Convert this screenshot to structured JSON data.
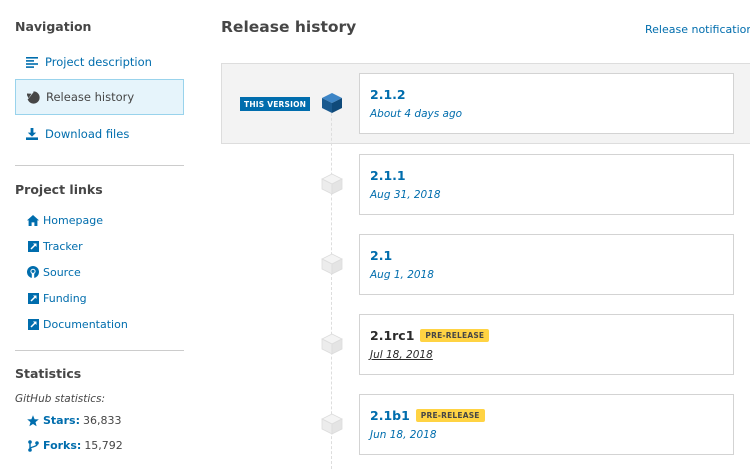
{
  "sidebar": {
    "navigation_heading": "Navigation",
    "nav": [
      {
        "label": "Project description",
        "icon": "align-left-icon"
      },
      {
        "label": "Release history",
        "icon": "history-icon",
        "active": true
      },
      {
        "label": "Download files",
        "icon": "download-icon"
      }
    ],
    "links_heading": "Project links",
    "links": [
      {
        "label": "Homepage",
        "icon": "home-icon"
      },
      {
        "label": "Tracker",
        "icon": "external-link-icon"
      },
      {
        "label": "Source",
        "icon": "github-icon"
      },
      {
        "label": "Funding",
        "icon": "external-link-icon"
      },
      {
        "label": "Documentation",
        "icon": "external-link-icon"
      }
    ],
    "statistics_heading": "Statistics",
    "github_label": "GitHub statistics:",
    "stats": [
      {
        "label": "Stars:",
        "value": "36,833",
        "icon": "star-icon"
      },
      {
        "label": "Forks:",
        "value": "15,792",
        "icon": "fork-icon"
      }
    ]
  },
  "main": {
    "title": "Release history",
    "notifications_link": "Release notifications",
    "this_version_badge": "THIS VERSION",
    "releases": [
      {
        "version": "2.1.2",
        "date": "About 4 days ago",
        "current": true
      },
      {
        "version": "2.1.1",
        "date": "Aug 31, 2018"
      },
      {
        "version": "2.1",
        "date": "Aug 1, 2018"
      },
      {
        "version": "2.1rc1",
        "date": "Jul 18, 2018",
        "pre_release": "PRE-RELEASE",
        "hovered": true
      },
      {
        "version": "2.1b1",
        "date": "Jun 18, 2018",
        "pre_release": "PRE-RELEASE"
      }
    ]
  },
  "colors": {
    "link": "#006dad",
    "text": "#464646",
    "pre_release_badge": "#ffd343",
    "active_nav_bg": "#e6f4fb"
  }
}
